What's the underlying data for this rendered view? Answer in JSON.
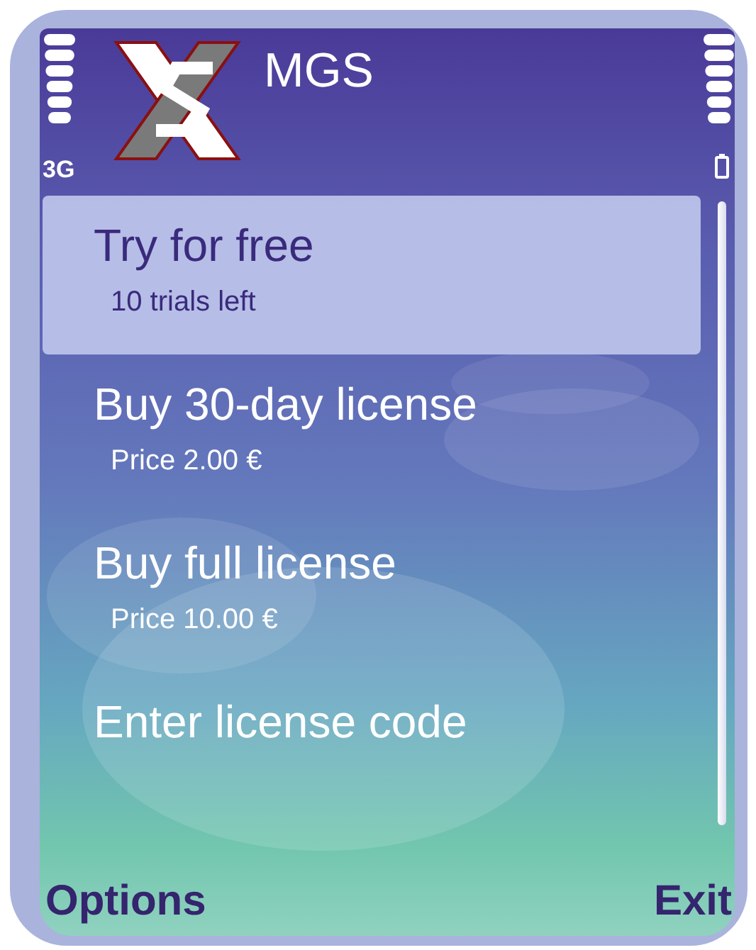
{
  "status": {
    "network": "3G"
  },
  "title": "MGS",
  "menu": [
    {
      "label": "Try for free",
      "detail": "10 trials left",
      "selected": true
    },
    {
      "label": "Buy 30-day license",
      "detail": "Price 2.00 €",
      "selected": false
    },
    {
      "label": "Buy full license",
      "detail": "Price 10.00 €",
      "selected": false
    },
    {
      "label": "Enter license code",
      "selected": false
    }
  ],
  "softkeys": {
    "left": "Options",
    "right": "Exit"
  }
}
